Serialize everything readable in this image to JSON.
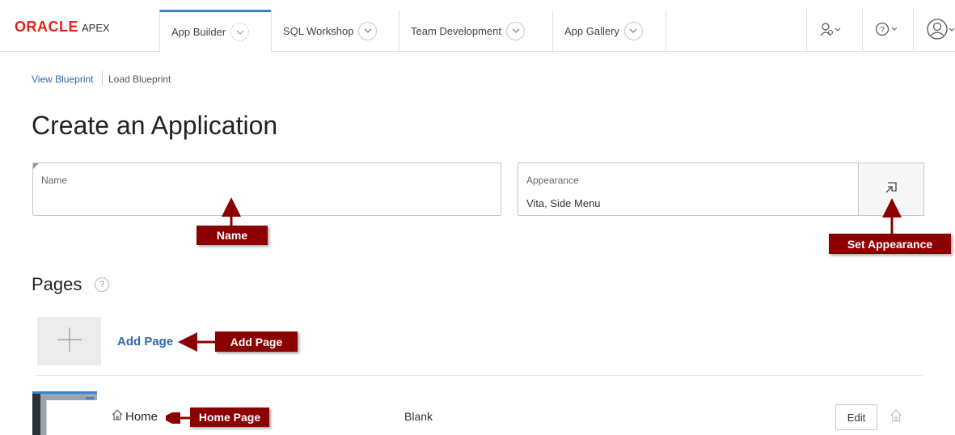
{
  "header": {
    "logo_oracle": "ORACLE",
    "logo_apex": "APEX",
    "tabs": [
      {
        "label": "App Builder",
        "active": true
      },
      {
        "label": "SQL Workshop"
      },
      {
        "label": "Team Development"
      },
      {
        "label": "App Gallery"
      }
    ],
    "icons": [
      "admin-icon",
      "help-icon",
      "user-icon"
    ]
  },
  "breadcrumb": {
    "link": "View Blueprint",
    "current": "Load Blueprint"
  },
  "page_title": "Create an Application",
  "name_field": {
    "label": "Name",
    "value": ""
  },
  "appearance_field": {
    "label": "Appearance",
    "value": "Vita, Side Menu"
  },
  "set_appearance_icon": "open-dialog-icon",
  "callouts": {
    "name": "Name",
    "set_appearance": "Set Appearance",
    "add_page": "Add Page",
    "home_page": "Home Page"
  },
  "pages_section": {
    "title": "Pages",
    "help_glyph": "?",
    "add_page_label": "Add Page",
    "rows": [
      {
        "name": "Home",
        "type": "Blank",
        "edit_label": "Edit"
      }
    ]
  },
  "colors": {
    "accent": "#3e83c9",
    "brand_red": "#e2231a",
    "callout": "#8b0000",
    "link": "#2f6aa8"
  }
}
